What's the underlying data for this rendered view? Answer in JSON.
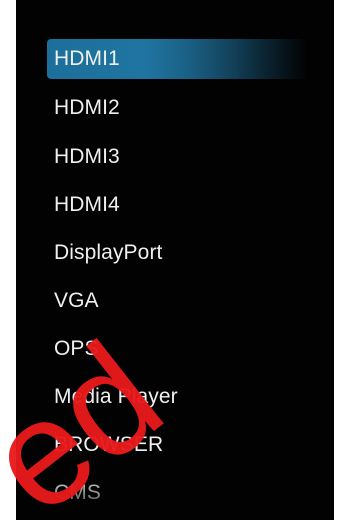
{
  "menu": {
    "items": [
      {
        "label": "HDMI1"
      },
      {
        "label": "HDMI2"
      },
      {
        "label": "HDMI3"
      },
      {
        "label": "HDMI4"
      },
      {
        "label": "DisplayPort"
      },
      {
        "label": "VGA"
      },
      {
        "label": "OPS"
      },
      {
        "label": "Media Player"
      },
      {
        "label": "BROWSER"
      },
      {
        "label": "CMS"
      }
    ],
    "selected_label": "HDMI1"
  },
  "watermark": {
    "text": "ed",
    "color": "#e8191b"
  },
  "colors": {
    "background": "#020202",
    "text": "#efefef",
    "highlight": "#1f75a1"
  }
}
